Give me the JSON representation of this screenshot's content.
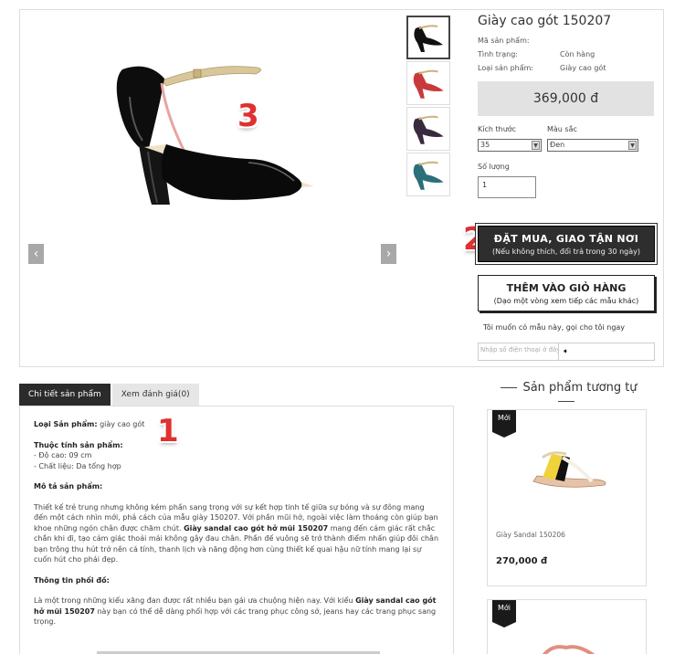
{
  "product": {
    "title": "Giày cao gót 150207",
    "fields": [
      {
        "label": "Mã sản phẩm:",
        "value": ""
      },
      {
        "label": "Tình trạng:",
        "value": "Còn hàng"
      },
      {
        "label": "Loại sản phẩm:",
        "value": "Giày cao gót"
      }
    ],
    "price": "369,000 đ",
    "size_label": "Kích thước",
    "size_value": "35",
    "color_label": "Màu sắc",
    "color_value": "Đen",
    "qty_label": "Số lượng",
    "qty_value": "1",
    "thumbnail_colors": [
      "#222222",
      "#c83a3a",
      "#3a2a40",
      "#2a6f7a"
    ]
  },
  "annotations": [
    "1",
    "2",
    "3"
  ],
  "gallery": {
    "prev": "‹",
    "next": "›"
  },
  "buttons": {
    "buy_main": "ĐẶT MUA, GIAO TẬN NƠI",
    "buy_sub": "(Nếu không thích, đổi trả trong 30 ngày)",
    "cart_main": "THÊM VÀO GIỎ HÀNG",
    "cart_sub": "(Dạo một vòng xem tiếp các mẫu khác)"
  },
  "callback": {
    "text": "Tôi muốn có mẫu này, gọi cho tôi ngay",
    "placeholder": "Nhập số điện thoại ở đây",
    "go": "➧"
  },
  "tabs": [
    "Chi tiết sản phẩm",
    "Xem đánh giá(0)"
  ],
  "description": {
    "type_label": "Loại Sản phẩm:",
    "type_value": "giày cao gót",
    "attr_title": "Thuộc tính sản phẩm:",
    "attr_1": "- Độ cao: 09 cm",
    "attr_2": "- Chất liệu: Da tổng hợp",
    "desc_title": "Mô tả sản phẩm:",
    "desc_p1": "Thiết kế trẻ trung nhưng không kém phần sang trọng với sự kết hợp tinh tế giữa sự bóng và sự đông mang đến một cách nhìn mới, phá cách của mẫu giày 150207. Với phần mũi hở, ngoài việc làm thoáng còn giúp bạn khoe những ngón chân được chăm chút.",
    "desc_p1_bold": "Giày sandal cao gót hở mũi 150207",
    "desc_p1_end": "mang đến cảm giác rất chắc chắn khi đi, tạo cảm giác thoải mái không gây đau chân. Phần đế vuông sẽ trở thành điểm nhấn giúp đôi chân bạn trông thu hút trở nên cá tính, thanh lịch và năng động hơn cùng thiết kế quai hậu nữ tính mang lại sự cuốn hút cho phái đẹp.",
    "mix_title": "Thông tin phối đồ:",
    "mix_p1": "Là một trong những kiểu xăng đan được rất nhiều bạn gái ưa chuộng hiện nay. Với kiểu",
    "mix_p1_bold": "Giày sandal cao gót hở mũi 150207",
    "mix_p1_end": "này bạn có thể dễ dàng phối hợp với các trang phục công sở, jeans hay các trang phục sang trọng."
  },
  "similar": {
    "title": "Sản phẩm tương tự",
    "items": [
      {
        "badge": "Mới",
        "name": "Giày Sandal 150206",
        "price": "270,000 đ"
      },
      {
        "badge": "Mới",
        "name": "",
        "price": ""
      }
    ]
  }
}
